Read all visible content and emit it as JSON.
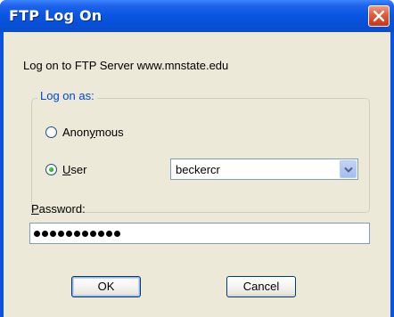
{
  "dialog": {
    "title": "FTP Log On",
    "server_text": "Log on to FTP Server www.mnstate.edu"
  },
  "logon_as": {
    "legend": "Log on as:",
    "anonymous": {
      "pre": "Anon",
      "accel": "y",
      "post": "mous",
      "selected": false
    },
    "user": {
      "accel": "U",
      "post": "ser",
      "selected": true
    }
  },
  "username_combo": {
    "value": "beckercr",
    "icon": "chevron-down-icon"
  },
  "password": {
    "label_accel": "P",
    "label_post": "assword:",
    "masked_length": 11
  },
  "buttons": {
    "ok": "OK",
    "cancel": "Cancel"
  },
  "colors": {
    "titlebar": "#0a56e4",
    "client_bg": "#ece9d8",
    "close_button": "#e2593a",
    "group_legend": "#0046d5"
  }
}
